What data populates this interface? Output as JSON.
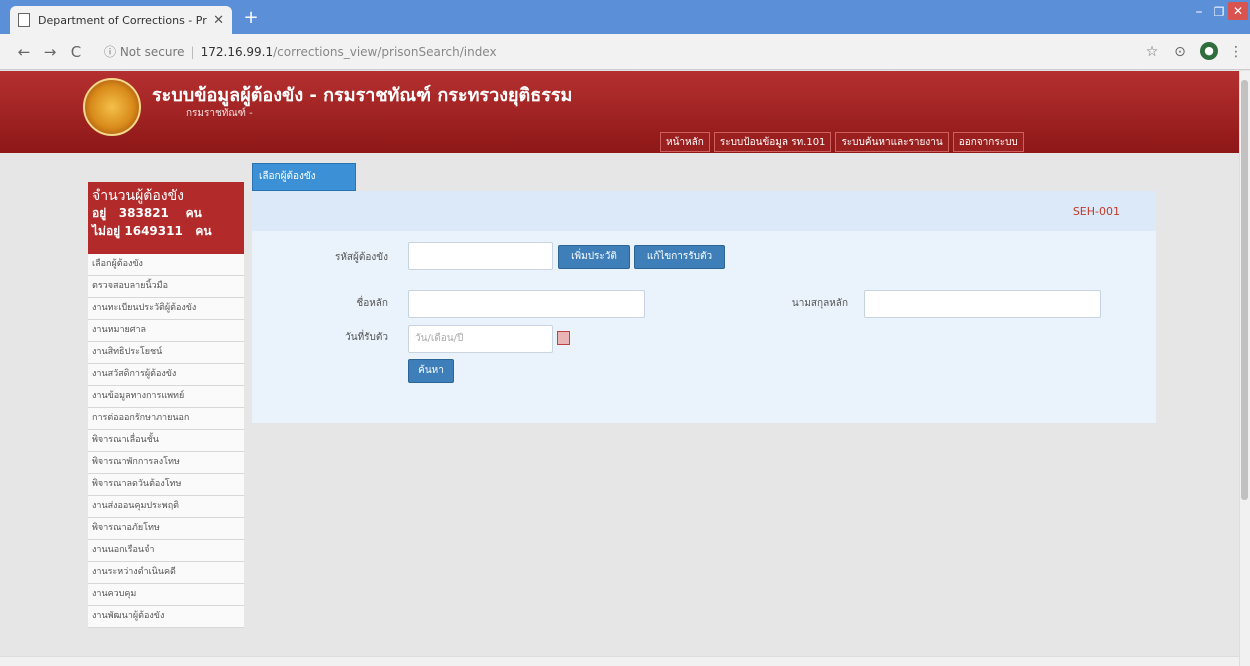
{
  "browser": {
    "tab_title": "Department of Corrections - Pris",
    "tab_close": "✕",
    "new_tab": "+",
    "url_security": "ⓘ Not secure",
    "url_host": "172.16.99.1",
    "url_path": "/corrections_view/prisonSearch/index",
    "back": "←",
    "forward": "→",
    "reload": "C",
    "star": "☆",
    "camera": "⊙",
    "menu": "⋮",
    "win_min": "–",
    "win_max": "❐",
    "win_close": "✕"
  },
  "header": {
    "title": "ระบบข้อมูลผู้ต้องขัง - กรมราชทัณฑ์ กระทรวงยุติธรรม",
    "subtitle": "กรมราชทัณฑ์ -",
    "nav": [
      "หน้าหลัก",
      "ระบบป้อนข้อมูล รท.101",
      "ระบบค้นหาและรายงาน",
      "ออกจากระบบ"
    ]
  },
  "counter": {
    "title": "จำนวนผู้ต้องขัง",
    "in_label": "อยู่",
    "in_value": "383821",
    "in_unit": "คน",
    "out_label": "ไม่อยู่",
    "out_value": "1649311",
    "out_unit": "คน"
  },
  "sidemenu": [
    "เลือกผู้ต้องขัง",
    "ตรวจสอบลายนิ้วมือ",
    "งานทะเบียนประวัติผู้ต้องขัง",
    "งานหมายศาล",
    "งานสิทธิประโยชน์",
    "งานสวัสดิการผู้ต้องขัง",
    "งานข้อมูลทางการแพทย์",
    "การต่อออกรักษาภายนอก",
    "พิจารณาเลื่อนชั้น",
    "พิจารณาพักการลงโทษ",
    "พิจารณาลดวันต้องโทษ",
    "งานส่งออนคุมประพฤติ",
    "พิจารณาอภัยโทษ",
    "งานนอกเรือนจำ",
    "งานระหว่างดำเนินคดี",
    "งานควบคุม",
    "งานพัฒนาผู้ต้องขัง"
  ],
  "section_tab": "เลือกผู้ต้องขัง",
  "panel": {
    "code": "SEH-001",
    "form": {
      "id_label": "รหัสผู้ต้องขัง",
      "id_value": "",
      "add_button": "เพิ่มประวัติ",
      "edit_button": "แก้ไขการรับตัว",
      "firstname_label": "ชื่อหลัก",
      "firstname_value": "",
      "lastname_label": "นามสกุลหลัก",
      "lastname_value": "",
      "date_label": "วันที่รับตัว",
      "date_placeholder": "วัน/เดือน/ปี",
      "search_button": "ค้นหา"
    }
  },
  "colors": {
    "header_red": "#a52424",
    "tab_blue": "#3b90d6",
    "panel_bg": "#eaf2fb",
    "chrome_blue": "#5b8fd8"
  }
}
